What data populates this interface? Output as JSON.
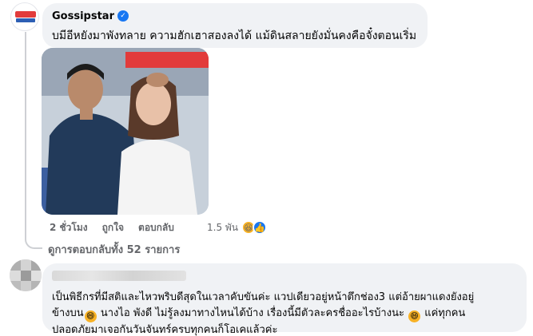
{
  "post_comment": {
    "author": "Gossipstar",
    "verified": true,
    "text": "บมีอีหยังมาพังทลาย ความฮักเฮาสองลงได้ แม้ดินสลายยังมั่นคงคือจั๋งตอนเริ่ม",
    "photo_alt": "man and crying woman on TV set",
    "actions": {
      "time": "2 ชั่วโมง",
      "like": "ถูกใจ",
      "reply": "ตอบกลับ"
    },
    "reaction_count": "1.5 พัน",
    "reaction_icons": [
      "haha-emoji",
      "like-thumb"
    ],
    "view_replies": "ดูการตอบกลับทั้ง 52 รายการ"
  },
  "reply": {
    "author_hidden": true,
    "lines": [
      "เป็นพิธีกรที่มีสติและไหวพริบดีสุดในเวลาคับขันค่ะ แวปเดียวอยู่หน้าตึกช่อง3 แต่อ้ายผาแดงยังอยู่",
      "ข้างบน",
      " นางไอ พังดี ไม่รู้ลงมาทางไหนได้บ้าง เรื่องนี้มีตัวละครชื่ออะไรบ้างนะ ",
      " แค่ทุกคน",
      "ปลอดภัยมาเจอกันวันจันทร์ครบทุกคนก็โอเคแล้วค่ะ"
    ],
    "emoji": "😄"
  },
  "colors": {
    "bubble": "#f0f2f5",
    "meta": "#65676b",
    "verified": "#1877f2",
    "haha": "#f7b125"
  }
}
